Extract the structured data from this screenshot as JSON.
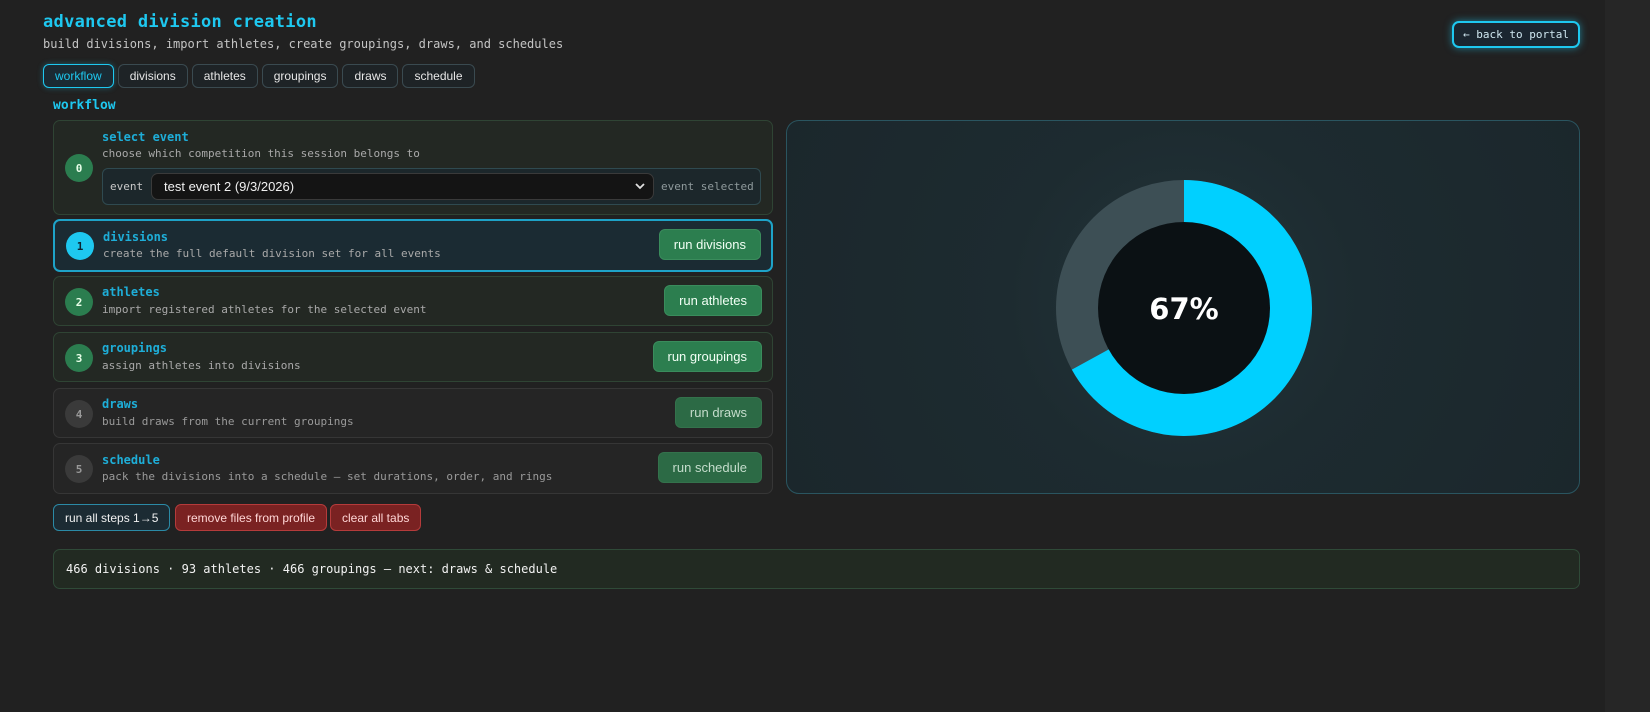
{
  "header": {
    "title": "advanced division creation",
    "subtitle": "build divisions, import athletes, create groupings, draws, and schedules",
    "back_label": "← back to portal"
  },
  "tabs": [
    {
      "label": "workflow",
      "active": true
    },
    {
      "label": "divisions",
      "active": false
    },
    {
      "label": "athletes",
      "active": false
    },
    {
      "label": "groupings",
      "active": false
    },
    {
      "label": "draws",
      "active": false
    },
    {
      "label": "schedule",
      "active": false
    }
  ],
  "workflow": {
    "section_title": "workflow",
    "select_event": {
      "number": "0",
      "title": "select event",
      "description": "choose which competition this session belongs to",
      "event_label": "event",
      "event_value": "test event 2 (9/3/2026)",
      "status": "event selected"
    },
    "steps": [
      {
        "number": "1",
        "title": "divisions",
        "description": "create the full default division set for all events",
        "button": "run divisions",
        "state": "active"
      },
      {
        "number": "2",
        "title": "athletes",
        "description": "import registered athletes for the selected event",
        "button": "run athletes",
        "state": "done"
      },
      {
        "number": "3",
        "title": "groupings",
        "description": "assign athletes into divisions",
        "button": "run groupings",
        "state": "done"
      },
      {
        "number": "4",
        "title": "draws",
        "description": "build draws from the current groupings",
        "button": "run draws",
        "state": "pending"
      },
      {
        "number": "5",
        "title": "schedule",
        "description": "pack the divisions into a schedule — set durations, order, and rings",
        "button": "run schedule",
        "state": "pending"
      }
    ],
    "actions": {
      "run_all": "run all steps 1→5",
      "remove_files": "remove files from profile",
      "clear_tabs": "clear all tabs"
    },
    "summary": "466 divisions · 93 athletes · 466 groupings — next: draws & schedule"
  },
  "progress": {
    "percent": 67,
    "label": "67%",
    "colors": {
      "fill": "#00d0ff",
      "track": "#3d4f55",
      "center": "#0b1114",
      "text": "#ffffff"
    }
  }
}
